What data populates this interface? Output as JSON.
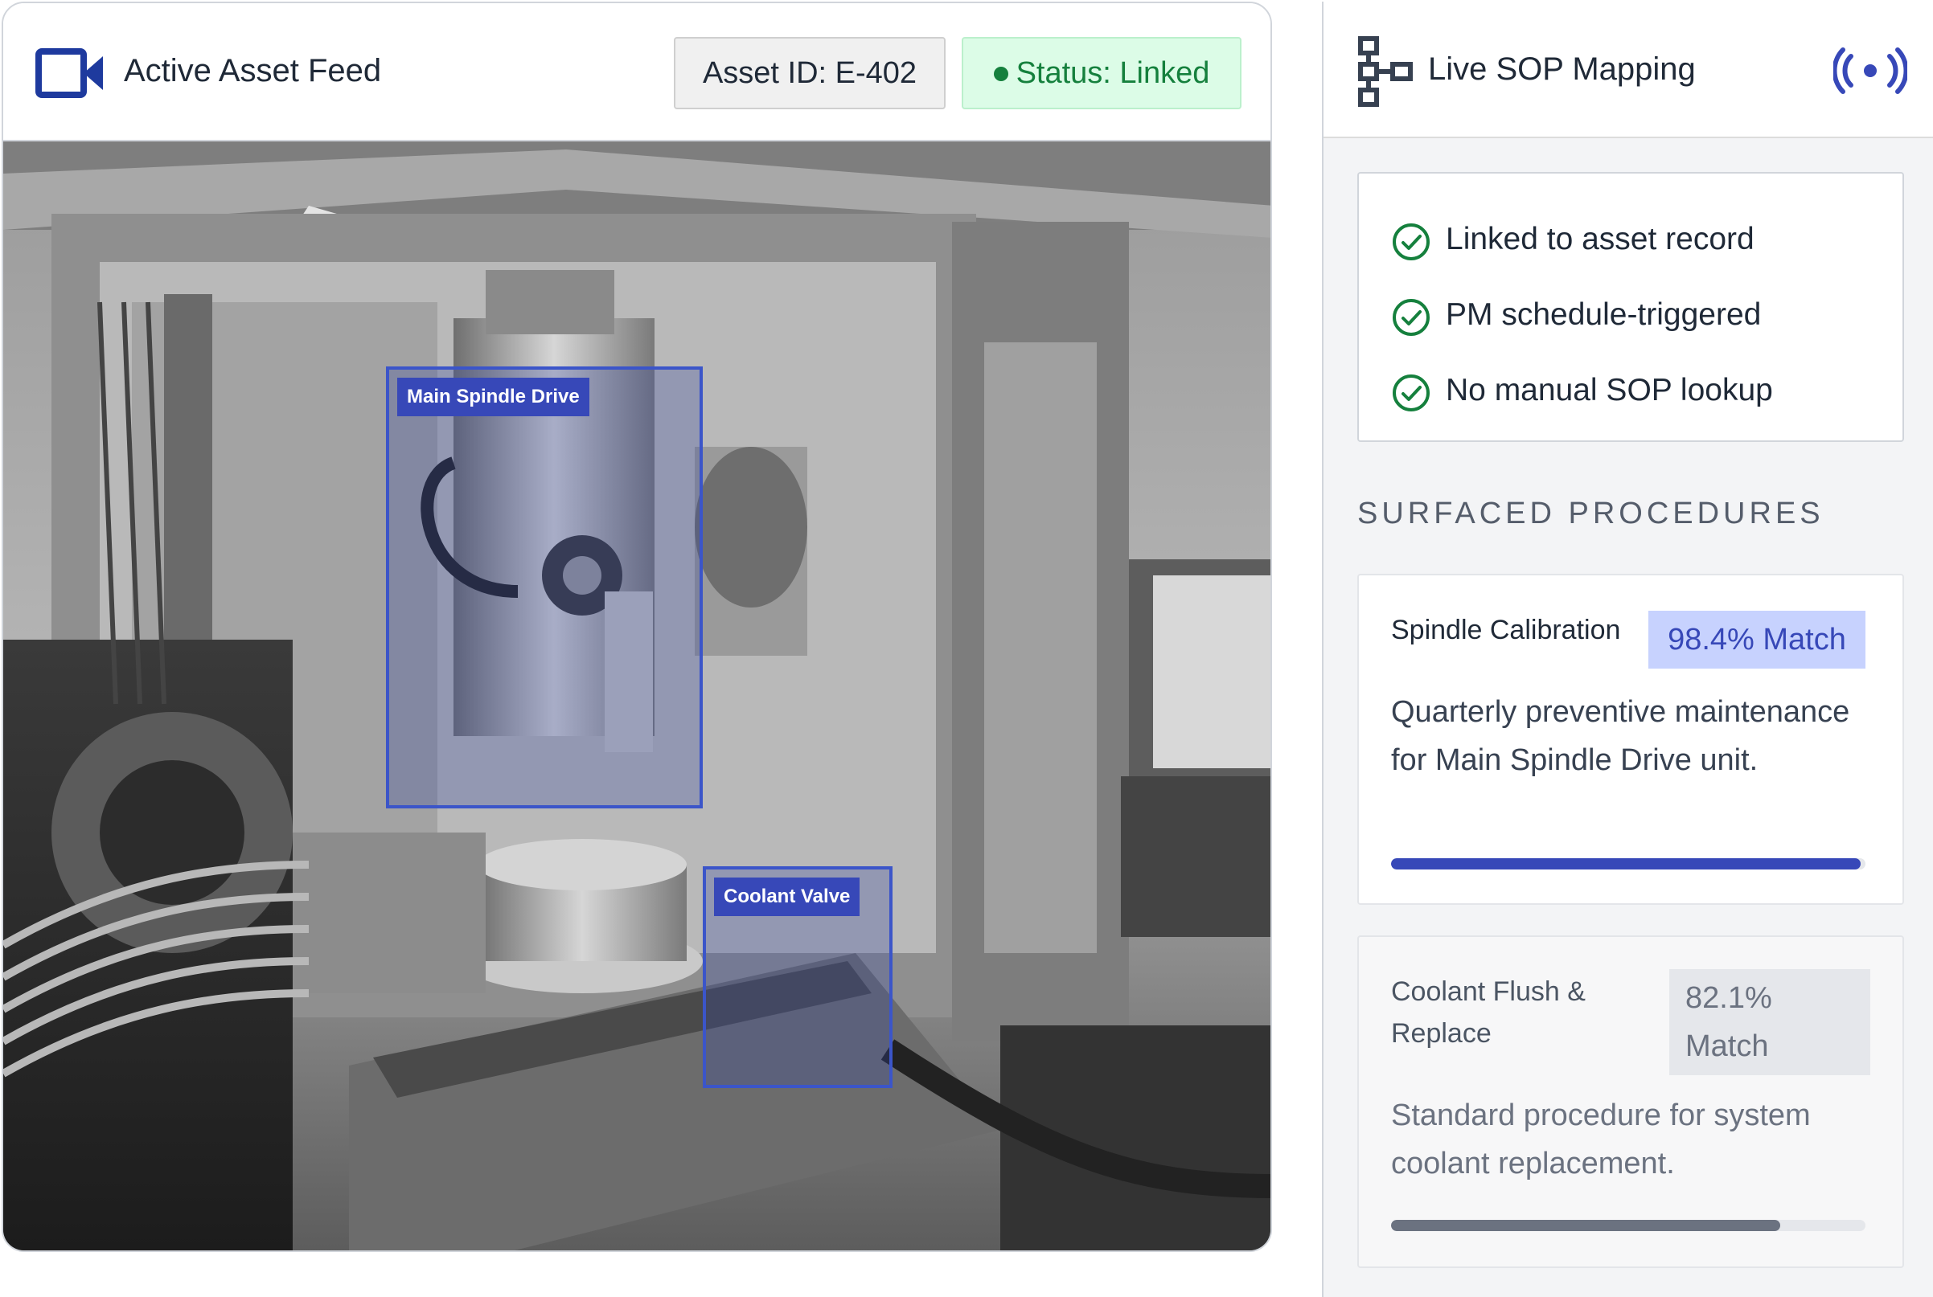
{
  "feed": {
    "title": "Active Asset Feed",
    "asset_id": "Asset ID: E-402",
    "status": "Status: Linked",
    "detections": [
      {
        "label": "Main Spindle Drive"
      },
      {
        "label": "Coolant Valve"
      }
    ]
  },
  "sop": {
    "title": "Live SOP Mapping",
    "checklist": [
      "Linked to asset record",
      "PM schedule-triggered",
      "No manual SOP lookup"
    ],
    "section_label": "SURFACED PROCEDURES",
    "procedures": [
      {
        "name": "Spindle Calibration",
        "match": "98.4% Match",
        "description": "Quarterly preventive maintenance for Main Spindle Drive unit.",
        "progress": 0.99
      },
      {
        "name": "Coolant Flush & Replace",
        "match": "82.1% Match",
        "description": "Standard procedure for system coolant replacement.",
        "progress": 0.82
      }
    ]
  },
  "colors": {
    "accent": "#3748b8",
    "status_green": "#15803d",
    "status_green_bg": "#dcfce7",
    "match_bg": "#c7d2fe",
    "check_green": "#15803d"
  },
  "icons": {
    "feed": "video-camera-icon",
    "sop": "sitemap-icon",
    "live": "broadcast-icon",
    "check": "check-circle-icon"
  }
}
